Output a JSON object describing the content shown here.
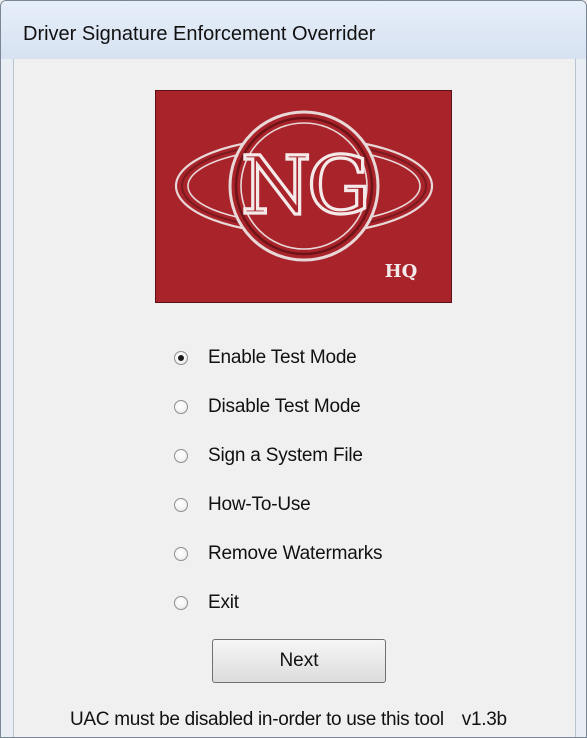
{
  "window": {
    "title": "Driver Signature Enforcement Overrider"
  },
  "logo": {
    "main_text": "NG",
    "sub_text": "HQ",
    "background_color": "#a9232a"
  },
  "options": [
    {
      "label": "Enable Test Mode",
      "checked": true
    },
    {
      "label": "Disable Test Mode",
      "checked": false
    },
    {
      "label": "Sign a System File",
      "checked": false
    },
    {
      "label": "How-To-Use",
      "checked": false
    },
    {
      "label": "Remove Watermarks",
      "checked": false
    },
    {
      "label": "Exit",
      "checked": false
    }
  ],
  "next_button": {
    "label": "Next"
  },
  "footer": {
    "note": "UAC must be disabled in-order to use this tool",
    "version": "v1.3b"
  }
}
